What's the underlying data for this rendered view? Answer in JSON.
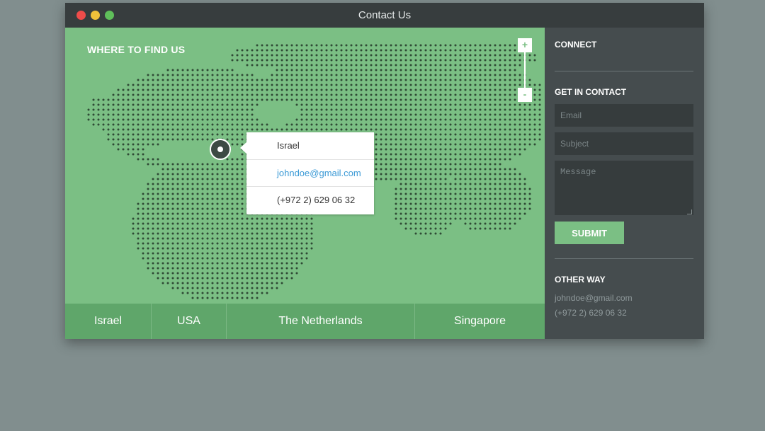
{
  "window": {
    "title": "Contact Us"
  },
  "map": {
    "heading": "WHERE TO FIND US",
    "zoom_in_label": "+",
    "zoom_out_label": "-",
    "popup": {
      "country": "Israel",
      "email": "johndoe@gmail.com",
      "phone": "(+972 2) 629 06 32"
    },
    "tabs": [
      "Israel",
      "USA",
      "The Netherlands",
      "Singapore"
    ]
  },
  "sidebar": {
    "connect_heading": "CONNECT",
    "contact_heading": "GET IN CONTACT",
    "email_placeholder": "Email",
    "subject_placeholder": "Subject",
    "message_placeholder": "Message",
    "submit_label": "SUBMIT",
    "other_heading": "OTHER WAY",
    "other_email": "johndoe@gmail.com",
    "other_phone": "(+972 2) 629 06 32"
  },
  "colors": {
    "map_green": "#7bbf84",
    "tab_green": "#5fa66a",
    "sidebar_bg": "#454c4e",
    "titlebar_bg": "#373d3e",
    "link_blue": "#3b9ad6"
  },
  "icons": [
    "close-dot",
    "minimize-dot",
    "maximize-dot",
    "location-pin-icon",
    "plus-icon",
    "minus-icon"
  ]
}
